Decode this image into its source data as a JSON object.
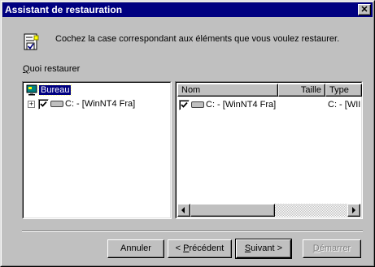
{
  "window": {
    "title": "Assistant de restauration",
    "close_glyph": "✕"
  },
  "header": {
    "icon": "restore-wizard-icon",
    "instruction": "Cochez la case correspondant aux éléments que vous voulez restaurer."
  },
  "section": {
    "label_accel": "Q",
    "label_rest": "uoi restaurer"
  },
  "tree": {
    "items": [
      {
        "label": "Bureau",
        "icon": "desktop-icon",
        "selected": true
      },
      {
        "label": "C: - [WinNT4 Fra]",
        "icon": "drive-icon",
        "checked": true,
        "expander": "+"
      }
    ]
  },
  "list": {
    "columns": [
      "Nom",
      "Taille",
      "Type"
    ],
    "rows": [
      {
        "name": "C: - [WinNT4 Fra]",
        "size": "",
        "type": "C: - [WII",
        "checked": true
      }
    ]
  },
  "buttons": {
    "cancel": "Annuler",
    "prev_prefix": "< ",
    "prev_accel": "P",
    "prev_rest": "récédent",
    "next_accel": "S",
    "next_rest": "uivant >",
    "finish_accel": "D",
    "finish_rest": "émarrer"
  },
  "colors": {
    "titlebar": "#000080",
    "face": "#c0c0c0",
    "selection": "#000080"
  }
}
